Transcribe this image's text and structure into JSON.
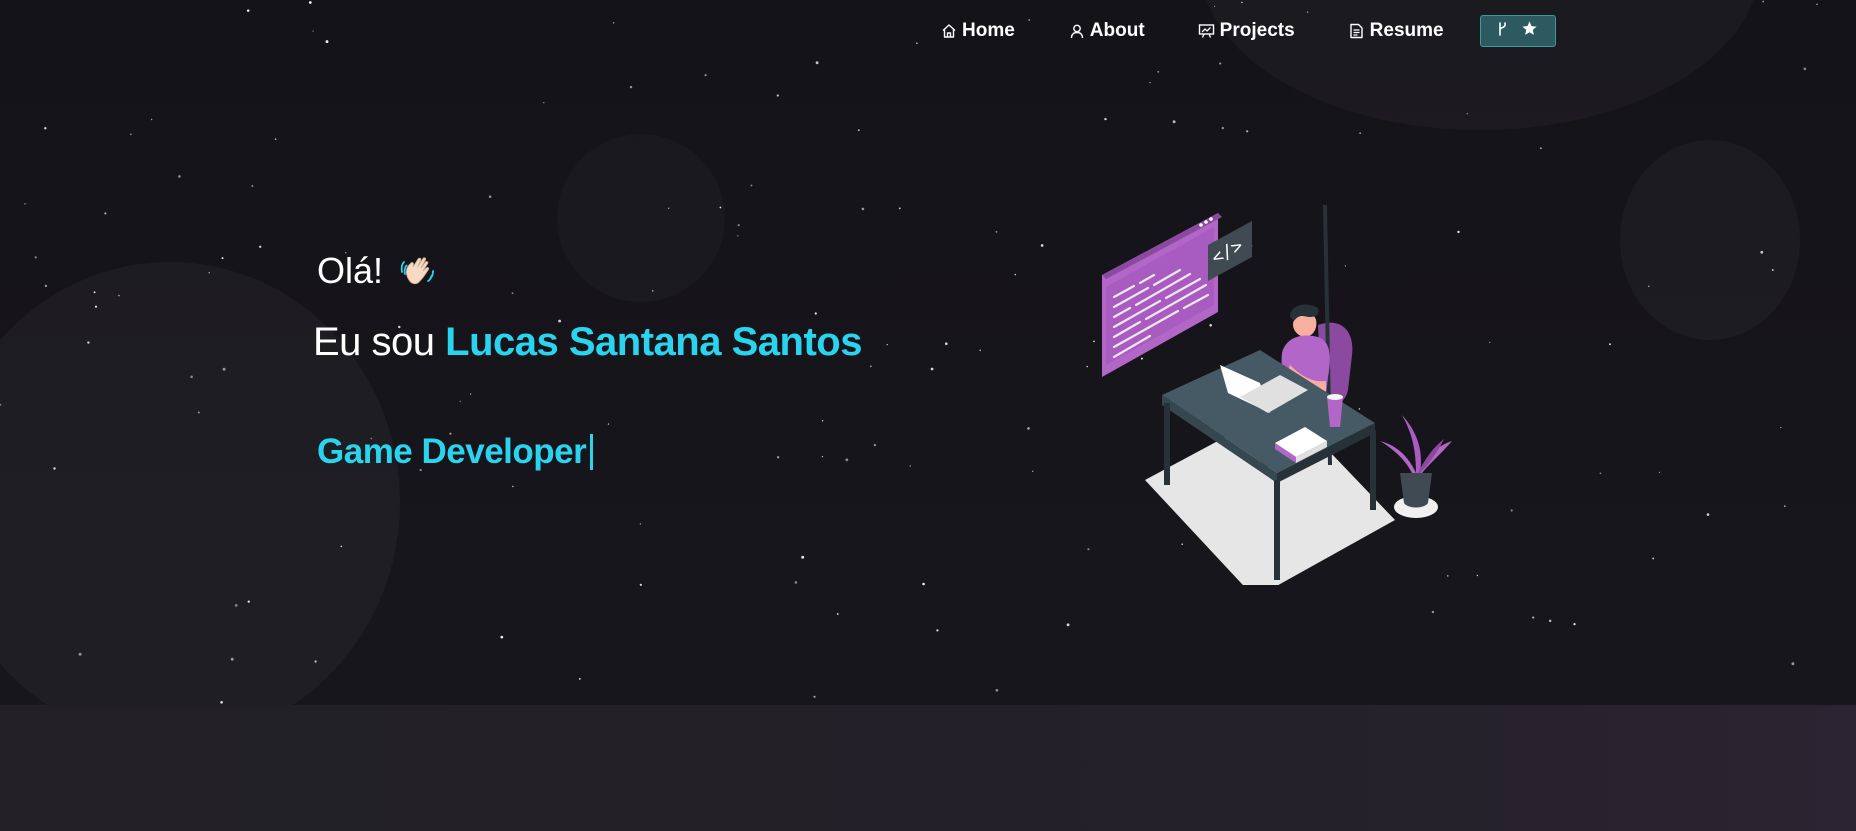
{
  "nav": {
    "items": [
      {
        "label": "Home",
        "icon": "home-icon"
      },
      {
        "label": "About",
        "icon": "user-icon"
      },
      {
        "label": "Projects",
        "icon": "presentation-icon"
      },
      {
        "label": "Resume",
        "icon": "document-icon"
      }
    ],
    "github_button": {
      "icons": [
        "git-fork-icon",
        "star-icon"
      ]
    }
  },
  "hero": {
    "greeting": "Olá!",
    "greeting_emoji": "waving-hand-icon",
    "intro_prefix": "Eu sou",
    "name": "Lucas Santana Santos",
    "role": "Game Developer"
  },
  "colors": {
    "background": "#16151a",
    "accent": "#2bd4ee",
    "button_bg": "#2d5961",
    "illustration_purple": "#b266c7"
  }
}
